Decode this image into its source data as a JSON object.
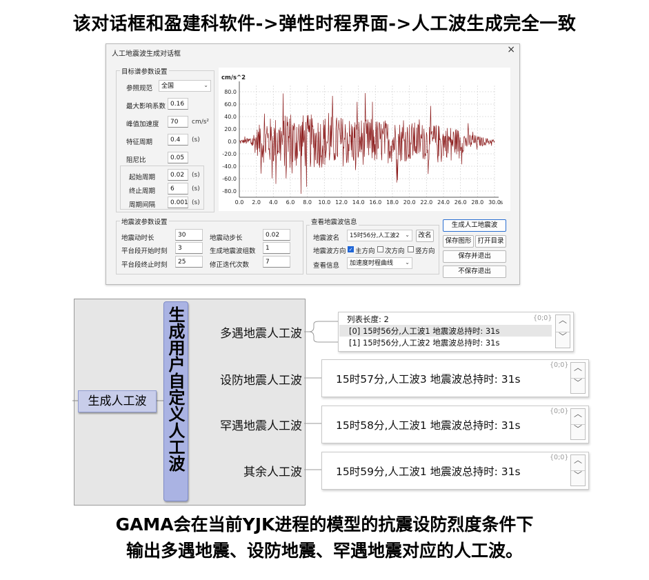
{
  "heading": "该对话框和盈建科软件->弹性时程界面->人工波生成完全一致",
  "dialog": {
    "title": "人工地震波生成对话框",
    "close_icon": "×",
    "target_group": {
      "label": "目标谱参数设置",
      "code_label": "参照规范",
      "code_value": "全国",
      "amax_label": "最大影响系数",
      "amax_value": "0.16",
      "pga_label": "峰值加速度",
      "pga_value": "70",
      "pga_unit": "cm/s²",
      "tg_label": "特征周期",
      "tg_value": "0.4",
      "tg_unit": "(s)",
      "damp_label": "阻尼比",
      "damp_value": "0.05",
      "t0_label": "起始周期",
      "t0_value": "0.02",
      "t0_unit": "(s)",
      "t1_label": "终止周期",
      "t1_value": "6",
      "t1_unit": "(s)",
      "dt_label": "周期间隔",
      "dt_value": "0.001",
      "dt_unit": "(s)"
    },
    "quake_group": {
      "label": "地震波参数设置",
      "dur_label": "地震动时长",
      "dur_value": "30",
      "step_label": "地震动步长",
      "step_value": "0.02",
      "pstart_label": "平台段开始时刻",
      "pstart_value": "3",
      "count_label": "生成地震波组数",
      "count_value": "1",
      "pend_label": "平台段终止时刻",
      "pend_value": "25",
      "iter_label": "修正迭代次数",
      "iter_value": "7"
    },
    "view_group": {
      "label": "查看地震波信息",
      "name_label": "地震波名",
      "name_value": "15时56分,人工波2",
      "rename": "改名",
      "dir_label": "地震波方向",
      "dir_main": "主方向",
      "dir_secondary": "次方向",
      "dir_vertical": "竖方向",
      "info_label": "查看信息",
      "info_value": "加速度时程曲线"
    },
    "buttons": {
      "generate": "生成人工地震波",
      "save_fig": "保存图形",
      "open_dir": "打开目录",
      "save_exit": "保存并退出",
      "nosave_exit": "不保存退出"
    }
  },
  "chart_data": {
    "type": "line",
    "unit_label": "cm/s^2",
    "x_unit": "s",
    "xlim": [
      0,
      30
    ],
    "ylim": [
      -90,
      90
    ],
    "x_ticks": [
      "0.0",
      "2.0",
      "4.0",
      "6.0",
      "8.0",
      "10.0",
      "12.0",
      "14.0",
      "16.0",
      "18.0",
      "20.0",
      "22.0",
      "24.0",
      "26.0",
      "28.0",
      "30.0"
    ],
    "y_ticks": [
      "80.0",
      "60.0",
      "40.0",
      "20.0",
      "0.0",
      "-20.0",
      "-40.0",
      "-60.0",
      "-80.0"
    ],
    "grid": true,
    "color": "#8b1a1a",
    "envelope": [
      [
        0,
        3
      ],
      [
        1,
        10
      ],
      [
        3,
        62
      ],
      [
        6,
        75
      ],
      [
        10,
        72
      ],
      [
        14,
        65
      ],
      [
        18,
        58
      ],
      [
        22,
        50
      ],
      [
        25,
        42
      ],
      [
        28,
        15
      ],
      [
        30,
        5
      ]
    ],
    "dt": 0.05
  },
  "mindmap": {
    "root": "生成人工波",
    "main": "生成用户自定义人工波",
    "branches": [
      {
        "label": "多遇地震人工波",
        "list_header": "列表长度: 2",
        "coord": "{0;0}",
        "items": [
          "[0] 15时56分,人工波1 地震波总持时: 31s",
          "[1] 15时56分,人工波2 地震波总持时: 31s"
        ]
      },
      {
        "label": "设防地震人工波",
        "value": "15时57分,人工波3 地震波总持时: 31s",
        "coord": "{0;0}"
      },
      {
        "label": "罕遇地震人工波",
        "value": "15时58分,人工波1 地震波总持时: 31s",
        "coord": "{0;0}"
      },
      {
        "label": "其余人工波",
        "value": "15时59分,人工波1 地震波总持时: 31s",
        "coord": "{0;0}"
      }
    ]
  },
  "caption": {
    "line1": "GAMA会在当前YJK进程的模型的抗震设防烈度条件下",
    "line2": "输出多遇地震、设防地震、罕遇地震对应的人工波。"
  }
}
